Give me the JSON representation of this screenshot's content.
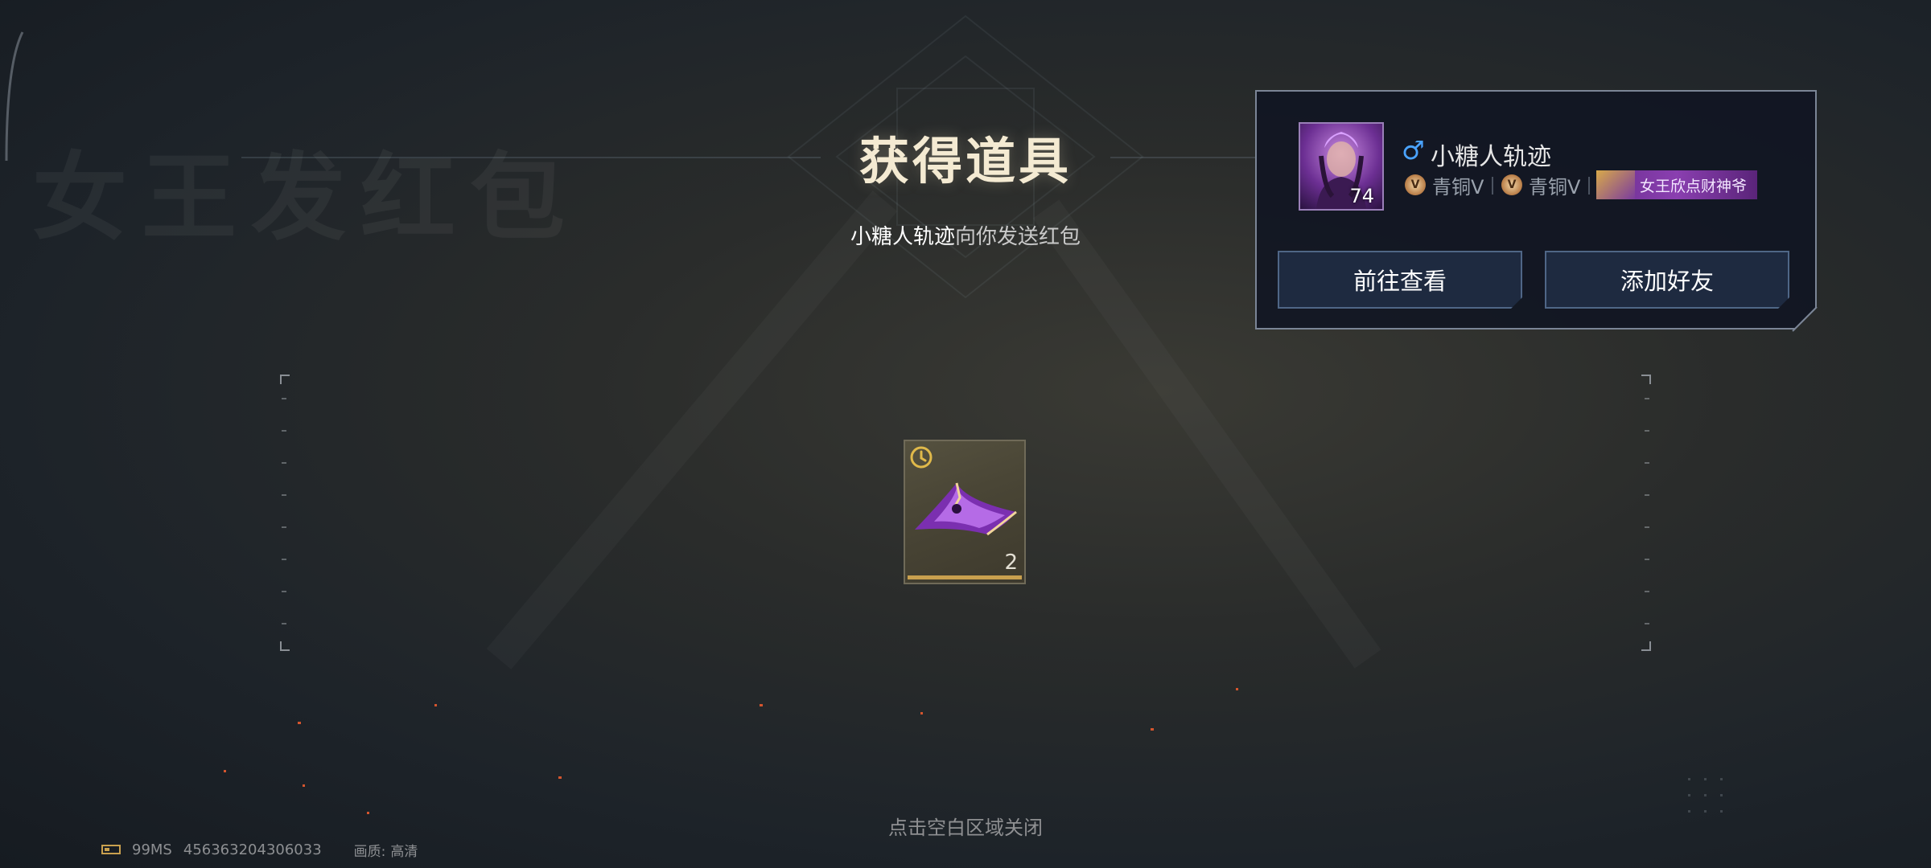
{
  "background": {
    "faded_title": "女王发红包"
  },
  "header": {
    "title": "获得道具",
    "subtitle_sender": "小糖人轨迹",
    "subtitle_rest": "向你发送红包"
  },
  "player_card": {
    "avatar_level": "74",
    "gender_icon": "male-icon",
    "name": "小糖人轨迹",
    "ranks": [
      {
        "badge": "V",
        "label": "青铜V"
      },
      {
        "badge": "V",
        "label": "青铜V"
      }
    ],
    "title_tag": "女王欣点财神爷",
    "buttons": {
      "view_label": "前往查看",
      "add_friend_label": "添加好友"
    }
  },
  "item": {
    "count": "2",
    "icon": "clock-icon",
    "timed": true,
    "rarity_color": "#c9a04e"
  },
  "close_hint": "点击空白区域关闭",
  "footer": {
    "ping": "99MS",
    "id": "456363204306033",
    "quality_label": "画质:",
    "quality_value": "高清"
  },
  "colors": {
    "accent_gold": "#c9a04e",
    "title_tag_purple": "#8a3fb0",
    "gender_blue": "#4aa3ff",
    "button_bg": "#1e2a40"
  }
}
